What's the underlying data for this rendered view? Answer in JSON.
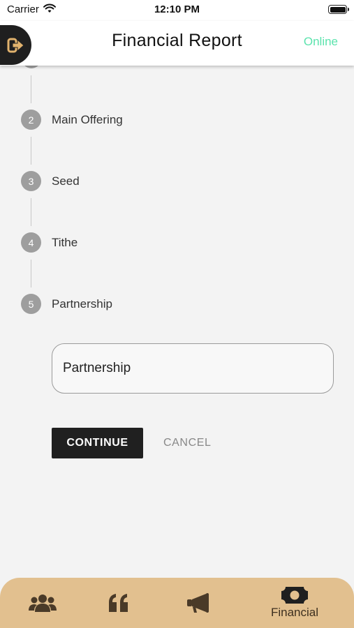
{
  "status_bar": {
    "carrier": "Carrier",
    "time": "12:10 PM"
  },
  "header": {
    "title": "Financial Report",
    "status": "Online"
  },
  "steps": [
    {
      "number": "2",
      "label": "Main Offering"
    },
    {
      "number": "3",
      "label": "Seed"
    },
    {
      "number": "4",
      "label": "Tithe"
    },
    {
      "number": "5",
      "label": "Partnership"
    }
  ],
  "active_step": {
    "input_value": "Partnership"
  },
  "actions": {
    "continue_label": "CONTINUE",
    "cancel_label": "CANCEL"
  },
  "bottom_nav": {
    "items": [
      {
        "icon": "users-icon"
      },
      {
        "icon": "quote-icon"
      },
      {
        "icon": "megaphone-icon"
      },
      {
        "icon": "money-bill-icon",
        "label": "Financial"
      }
    ]
  },
  "colors": {
    "accent": "#e2c08f",
    "online": "#5be3ad",
    "dark": "#202020",
    "step": "#9e9e9e"
  }
}
